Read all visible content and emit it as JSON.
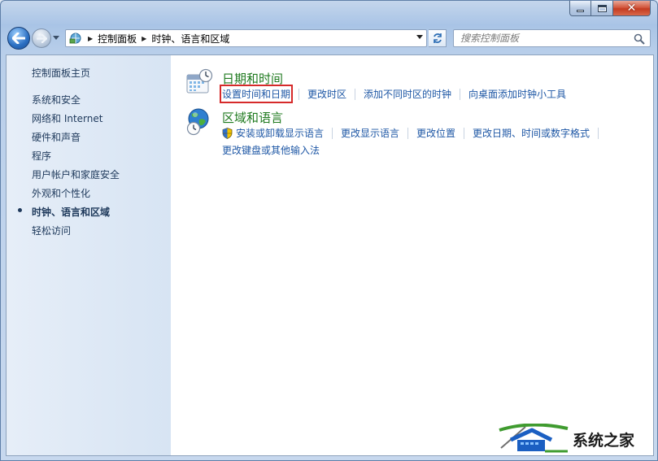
{
  "window": {
    "caption": {
      "close_glyph": "✕"
    }
  },
  "nav": {
    "back_icon": "back-arrow-icon",
    "forward_icon": "forward-arrow-icon"
  },
  "address": {
    "crumbs": [
      "控制面板",
      "时钟、语言和区域"
    ]
  },
  "search": {
    "placeholder": "搜索控制面板"
  },
  "sidebar": {
    "home": "控制面板主页",
    "items": [
      {
        "label": "系统和安全"
      },
      {
        "label": "网络和 Internet"
      },
      {
        "label": "硬件和声音"
      },
      {
        "label": "程序"
      },
      {
        "label": "用户帐户和家庭安全"
      },
      {
        "label": "外观和个性化"
      },
      {
        "label": "时钟、语言和区域",
        "current": true
      },
      {
        "label": "轻松访问"
      }
    ]
  },
  "categories": [
    {
      "title": "日期和时间",
      "icon": "calendar-clock-icon",
      "tasks": [
        "设置时间和日期",
        "更改时区",
        "添加不同时区的时钟",
        "向桌面添加时钟小工具"
      ],
      "highlighted_task": "设置时间和日期"
    },
    {
      "title": "区域和语言",
      "icon": "globe-clock-icon",
      "tasks": [
        "安装或卸载显示语言",
        "更改显示语言",
        "更改位置",
        "更改日期、时间或数字格式",
        "更改键盘或其他输入法"
      ]
    }
  ],
  "watermark": {
    "text": "系统之家"
  },
  "colors": {
    "accent_link": "#1e57a5",
    "category_title": "#1f7a1f",
    "highlight": "#d62a2a"
  }
}
